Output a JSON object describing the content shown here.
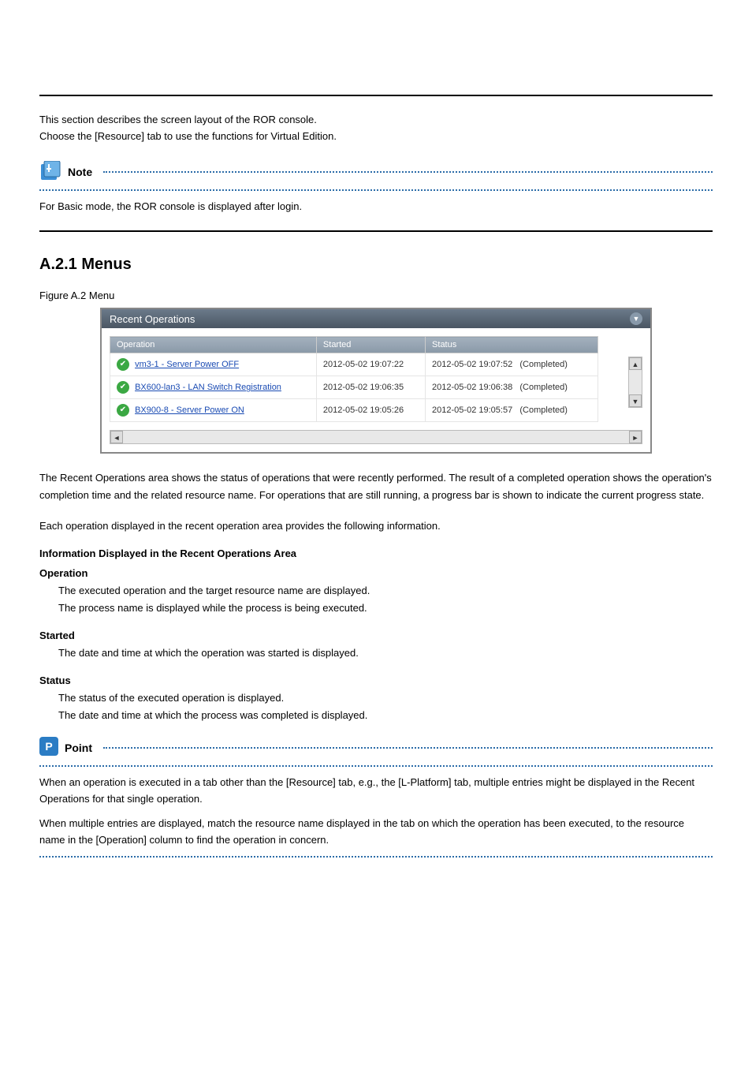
{
  "intro": {
    "para1": "This section describes the screen layout of the ROR console.",
    "para2": "Choose the [Resource] tab to use the functions for Virtual Edition."
  },
  "note": {
    "label": "Note",
    "content": "For Basic mode, the ROR console is displayed after login."
  },
  "subsection_title": "A.2.1 Menus",
  "figure_caption": "Figure A.2 Menu",
  "panel": {
    "title": "Recent Operations",
    "columns": {
      "operation": "Operation",
      "started": "Started",
      "status": "Status"
    },
    "rows": [
      {
        "operation": "vm3-1 - Server Power OFF",
        "started": "2012-05-02 19:07:22",
        "status_ts": "2012-05-02 19:07:52",
        "status_state": "(Completed)"
      },
      {
        "operation": "BX600-lan3 - LAN Switch Registration",
        "started": "2012-05-02 19:06:35",
        "status_ts": "2012-05-02 19:06:38",
        "status_state": "(Completed)"
      },
      {
        "operation": "BX900-8 - Server Power ON",
        "started": "2012-05-02 19:05:26",
        "status_ts": "2012-05-02 19:05:57",
        "status_state": "(Completed)"
      }
    ]
  },
  "body": {
    "p1": "The Recent Operations area shows the status of operations that were recently performed. The result of a completed operation shows the operation's completion time and the related resource name. For operations that are still running, a progress bar is shown to indicate the current progress state.",
    "p2": "Each operation displayed in the recent operation area provides the following information.",
    "info_title": "Information Displayed in the Recent Operations Area",
    "operation_label": "Operation",
    "operation_desc": "The executed operation and the target resource name are displayed.\nThe process name is displayed while the process is being executed.",
    "started_label": "Started",
    "started_desc": "The date and time at which the operation was started is displayed.",
    "status_label": "Status",
    "status_desc": "The status of the executed operation is displayed.\nThe date and time at which the process was completed is displayed."
  },
  "point": {
    "label": "Point",
    "content1": "When an operation is executed in a tab other than the [Resource] tab, e.g., the [L-Platform] tab, multiple entries might be displayed in the Recent Operations for that single operation.",
    "content2": "When multiple entries are displayed, match the resource name displayed in the tab on which the operation has been executed, to the resource name in the [Operation] column to find the operation in concern."
  }
}
